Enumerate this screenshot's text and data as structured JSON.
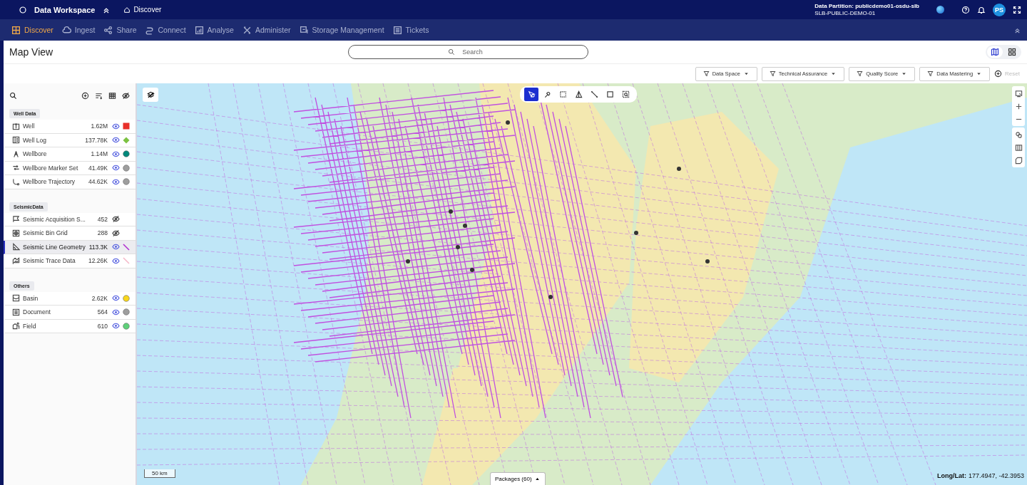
{
  "app": {
    "title": "Data Workspace",
    "breadcrumb": "Discover",
    "partition_label": "Data Partition: publicdemo01-osdu-slb",
    "partition_id": "SLB-PUBLIC-DEMO-01",
    "avatar": "PS"
  },
  "nav": [
    {
      "label": "Discover",
      "selected": true
    },
    {
      "label": "Ingest",
      "selected": false
    },
    {
      "label": "Share",
      "selected": false
    },
    {
      "label": "Connect",
      "selected": false
    },
    {
      "label": "Analyse",
      "selected": false
    },
    {
      "label": "Administer",
      "selected": false
    },
    {
      "label": "Storage Management",
      "selected": false
    },
    {
      "label": "Tickets",
      "selected": false
    }
  ],
  "page": {
    "title": "Map View",
    "search_placeholder": "Search",
    "views": [
      {
        "selected": true
      },
      {
        "selected": false
      }
    ]
  },
  "filters": [
    "Data Space",
    "Technical Assurance",
    "Quality Score",
    "Data Mastering"
  ],
  "reset": {
    "label": "Reset",
    "disabled": true
  },
  "layers": [
    {
      "group": "Well Data",
      "items": [
        {
          "name": "Well",
          "count": "1.62M",
          "visible": true,
          "kind": "square",
          "color": "#e8302a",
          "selected": false
        },
        {
          "name": "Well Log",
          "count": "137.78K",
          "visible": true,
          "kind": "diamond",
          "color": "#7cc242",
          "selected": false
        },
        {
          "name": "Wellbore",
          "count": "1.14M",
          "visible": true,
          "kind": "circle",
          "color": "#00897b",
          "selected": false
        },
        {
          "name": "Wellbore Marker Set",
          "count": "41.49K",
          "visible": true,
          "kind": "circle",
          "color": "#9e9e9e",
          "selected": false
        },
        {
          "name": "Wellbore Trajectory",
          "count": "44.62K",
          "visible": true,
          "kind": "circle",
          "color": "#9e9e9e",
          "selected": false
        }
      ]
    },
    {
      "group": "SeismicData",
      "items": [
        {
          "name": "Seismic Acquisition S...",
          "count": "452",
          "visible": false,
          "selected": false
        },
        {
          "name": "Seismic Bin Grid",
          "count": "288",
          "visible": false,
          "selected": false
        },
        {
          "name": "Seismic Line Geometry",
          "count": "113.3K",
          "visible": true,
          "kind": "line",
          "color": "#b02fd0",
          "selected": true
        },
        {
          "name": "Seismic Trace Data",
          "count": "12.26K",
          "visible": true,
          "kind": "line",
          "color": "#f4b8c8",
          "selected": false
        }
      ]
    },
    {
      "group": "Others",
      "items": [
        {
          "name": "Basin",
          "count": "2.62K",
          "visible": true,
          "kind": "circle",
          "color": "#f9d71c",
          "selected": false
        },
        {
          "name": "Document",
          "count": "564",
          "visible": true,
          "kind": "circle",
          "color": "#9e9e9e",
          "selected": false
        },
        {
          "name": "Field",
          "count": "610",
          "visible": true,
          "kind": "circle",
          "color": "#5fd17a",
          "selected": false
        }
      ]
    }
  ],
  "map": {
    "tools": [
      {
        "selected": true
      },
      {
        "selected": false
      },
      {
        "selected": false
      },
      {
        "selected": false
      },
      {
        "selected": false
      },
      {
        "selected": false
      },
      {
        "selected": false
      }
    ],
    "scale": "50 km",
    "packages": "Packages (60)",
    "coordinates_label": "Long/Lat:",
    "coordinates": "177.4947, -42.3953"
  }
}
